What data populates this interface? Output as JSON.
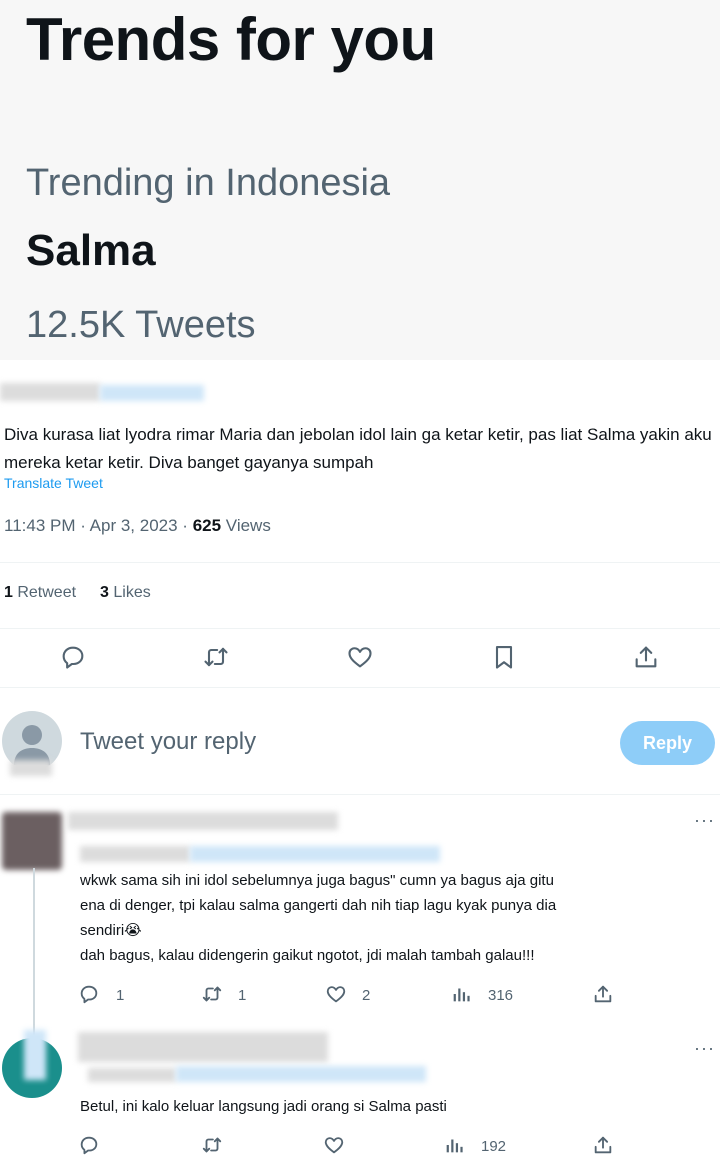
{
  "trends": {
    "title": "Trends for you",
    "context": "Trending in Indonesia",
    "name": "Salma",
    "count": "12.5K Tweets"
  },
  "tweet": {
    "text": "Diva kurasa liat lyodra rimar Maria dan jebolan idol lain ga ketar ketir, pas liat Salma yakin aku mereka ketar ketir. Diva banget gayanya sumpah",
    "translate": "Translate Tweet",
    "time": "11:43 PM · Apr 3, 2023 · ",
    "views_count": "625",
    "views_label": " Views",
    "retweets_count": "1",
    "retweets_label": " Retweet",
    "likes_count": "3",
    "likes_label": " Likes"
  },
  "composer": {
    "placeholder": "Tweet your reply",
    "reply_label": "Reply"
  },
  "replies": [
    {
      "text_line1": "wkwk sama sih ini idol sebelumnya juga bagus\" cumn ya bagus aja gitu",
      "text_line2": "ena di denger, tpi kalau salma gangerti dah nih tiap lagu kyak punya dia",
      "text_line3": "sendiri😭",
      "text_line4": "dah bagus, kalau didengerin gaikut ngotot, jdi malah tambah galau!!!",
      "replies": "1",
      "retweets": "1",
      "likes": "2",
      "views": "316",
      "more": "···"
    },
    {
      "text_line1": "Betul, ini kalo keluar langsung jadi orang si Salma pasti",
      "views": "192",
      "more": "···"
    }
  ],
  "colors": {
    "accent": "#1d9bf0",
    "reply_button": "#8ecdf8",
    "muted": "#536471",
    "trends_bg": "#f7f7f7"
  },
  "icons": [
    "reply-icon",
    "retweet-icon",
    "like-icon",
    "bookmark-icon",
    "share-icon",
    "views-icon",
    "more-icon",
    "avatar-icon"
  ]
}
